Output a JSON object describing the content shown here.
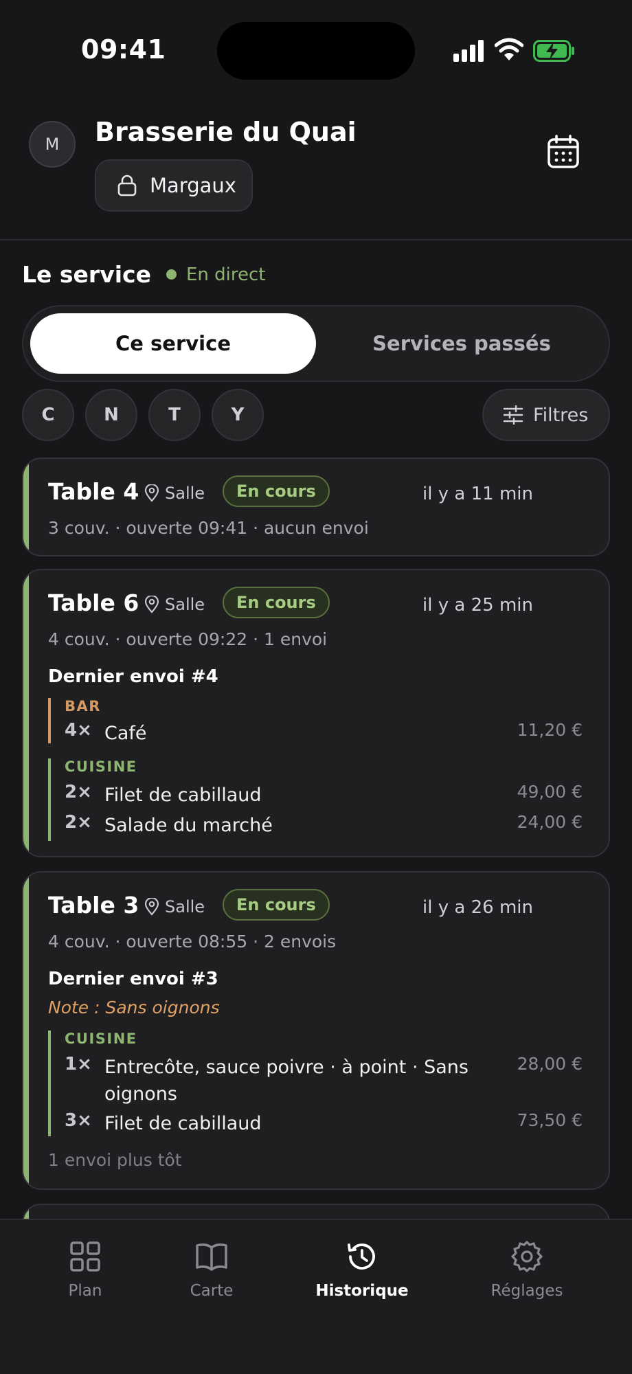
{
  "status_bar": {
    "time": "09:41"
  },
  "header": {
    "avatar_initial": "M",
    "restaurant_name": "Brasserie du Quai",
    "user_name": "Margaux"
  },
  "service": {
    "title": "Le service",
    "live_label": "En direct"
  },
  "tabs": {
    "current": "Ce service",
    "past": "Services passés"
  },
  "filter_chips": [
    "C",
    "N",
    "T",
    "Y"
  ],
  "filters_label": "Filtres",
  "cards": [
    {
      "table": "Table 4",
      "location": "Salle",
      "status": "En cours",
      "time_ago": "il y a 11 min",
      "meta": "3 couv. · ouverte 09:41 · aucun envoi"
    },
    {
      "table": "Table 6",
      "location": "Salle",
      "status": "En cours",
      "time_ago": "il y a 25 min",
      "meta": "4 couv. · ouverte 09:22 · 1 envoi",
      "dispatch_title": "Dernier envoi #4",
      "stations": [
        {
          "name": "BAR",
          "items": [
            {
              "qty": "4×",
              "name": "Café",
              "price": "11,20 €"
            }
          ]
        },
        {
          "name": "CUISINE",
          "items": [
            {
              "qty": "2×",
              "name": "Filet de cabillaud",
              "price": "49,00 €"
            },
            {
              "qty": "2×",
              "name": "Salade du marché",
              "price": "24,00 €"
            }
          ]
        }
      ]
    },
    {
      "table": "Table 3",
      "location": "Salle",
      "status": "En cours",
      "time_ago": "il y a 26 min",
      "meta": "4 couv. · ouverte 08:55 · 2 envois",
      "dispatch_title": "Dernier envoi #3",
      "note": "Note : Sans oignons",
      "stations": [
        {
          "name": "CUISINE",
          "items": [
            {
              "qty": "1×",
              "name": "Entrecôte, sauce poivre · à point · Sans oignons",
              "price": "28,00 €"
            },
            {
              "qty": "3×",
              "name": "Filet de cabillaud",
              "price": "73,50 €"
            }
          ]
        }
      ],
      "earlier": "1 envoi plus tôt"
    }
  ],
  "nav": [
    {
      "label": "Plan",
      "icon": "grid-icon"
    },
    {
      "label": "Carte",
      "icon": "book-icon"
    },
    {
      "label": "Historique",
      "icon": "history-icon",
      "active": true
    },
    {
      "label": "Réglages",
      "icon": "gear-icon"
    }
  ],
  "colors": {
    "background": "#17171a",
    "accent_green": "#8db56f",
    "bar_station": "#d39a63",
    "note_orange": "#e0a064"
  }
}
